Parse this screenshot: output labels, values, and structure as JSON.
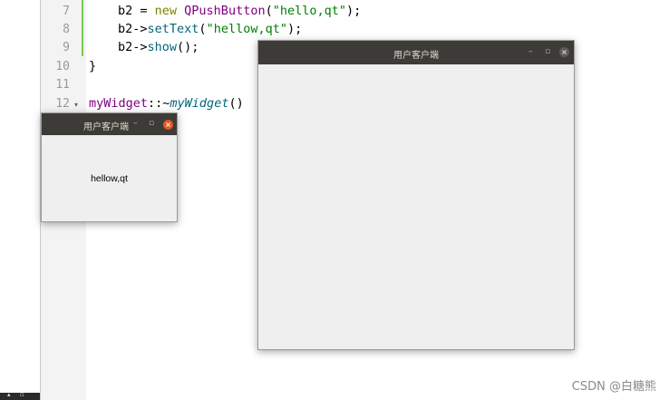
{
  "editor": {
    "line_numbers": [
      "7",
      "8",
      "9",
      "10",
      "11",
      "12"
    ],
    "line7": {
      "a": "b2 = ",
      "kw": "new",
      "cls": "QPushButton",
      "open": "(",
      "str": "\"hello,qt\"",
      "close": ");"
    },
    "line8": {
      "a": "b2->",
      "fn": "setText",
      "open": "(",
      "str": "\"hellow,qt\"",
      "close": ");"
    },
    "line9": {
      "a": "b2->",
      "fn": "show",
      "close": "();"
    },
    "line10": {
      "text": "}"
    },
    "line12": {
      "cls": "myWidget",
      "sep": "::~",
      "fn": "myWidget",
      "close": "()"
    }
  },
  "small_window": {
    "title": "用户客户端",
    "minimize_glyph": "–",
    "maximize_glyph": "▫",
    "close_glyph": "×",
    "button_text": "hellow,qt"
  },
  "large_window": {
    "title": "用户客户端",
    "minimize_glyph": "–",
    "maximize_glyph": "▫",
    "close_glyph": "×"
  },
  "watermark": "CSDN @白糖熊",
  "colors": {
    "titlebar": "#3c3b37",
    "close_active": "#e95420",
    "window_bg": "#efefef",
    "keyword": "#808000",
    "class": "#800080",
    "function": "#00677c",
    "string": "#008000"
  }
}
